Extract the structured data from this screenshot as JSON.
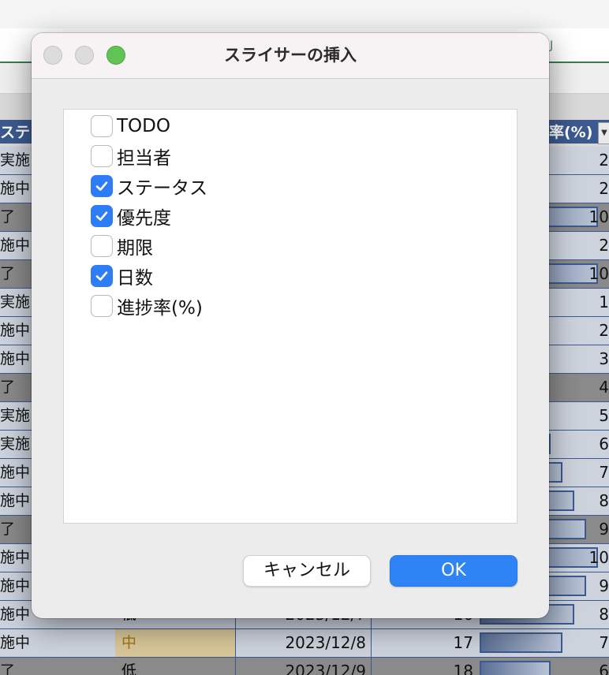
{
  "spreadsheet": {
    "header_left": "ステ",
    "header_right": "率(%)",
    "green_mark": "J",
    "rows": [
      {
        "left": "実施",
        "tone": "light",
        "right": "2",
        "bar": 0
      },
      {
        "left": "施中",
        "tone": "light",
        "right": "2",
        "bar": 0
      },
      {
        "left": "了",
        "tone": "dark",
        "right": "10",
        "bar": 1.0
      },
      {
        "left": "施中",
        "tone": "light",
        "right": "2",
        "bar": 0
      },
      {
        "left": "了",
        "tone": "dark",
        "right": "10",
        "bar": 1.0
      },
      {
        "left": "実施",
        "tone": "light",
        "right": "1",
        "bar": 0
      },
      {
        "left": "施中",
        "tone": "light",
        "right": "2",
        "bar": 0
      },
      {
        "left": "施中",
        "tone": "light",
        "right": "3",
        "bar": 0
      },
      {
        "left": "了",
        "tone": "dark",
        "right": "4",
        "bar": 0
      },
      {
        "left": "実施",
        "tone": "light",
        "right": "5",
        "bar": 0.5
      },
      {
        "left": "実施",
        "tone": "light",
        "right": "6",
        "bar": 0.6
      },
      {
        "left": "施中",
        "tone": "light",
        "right": "7",
        "bar": 0.7
      },
      {
        "left": "施中",
        "tone": "light",
        "right": "8",
        "bar": 0.8
      },
      {
        "left": "了",
        "tone": "dark",
        "right": "9",
        "bar": 0.9
      },
      {
        "left": "施中",
        "tone": "light",
        "right": "10",
        "bar": 1.0
      },
      {
        "left": "施中",
        "tone": "light",
        "right": "9",
        "bar": 0.9
      },
      {
        "left": "施中",
        "tone": "light",
        "right": "8",
        "bar": 0.8,
        "priority": "低",
        "date": "2023/12/7",
        "days": "16"
      },
      {
        "left": "施中",
        "tone": "light",
        "right": "7",
        "bar": 0.7,
        "priority": "中",
        "date": "2023/12/8",
        "days": "17"
      },
      {
        "left": "了",
        "tone": "dark",
        "right": "6",
        "bar": 0.6,
        "priority": "低",
        "date": "2023/12/9",
        "days": "18"
      }
    ]
  },
  "dialog": {
    "title": "スライサーの挿入",
    "fields": [
      {
        "label": "TODO",
        "checked": false
      },
      {
        "label": "担当者",
        "checked": false
      },
      {
        "label": "ステータス",
        "checked": true
      },
      {
        "label": "優先度",
        "checked": true
      },
      {
        "label": "期限",
        "checked": false
      },
      {
        "label": "日数",
        "checked": true
      },
      {
        "label": "進捗率(%)",
        "checked": false
      }
    ],
    "cancel_label": "キャンセル",
    "ok_label": "OK"
  }
}
